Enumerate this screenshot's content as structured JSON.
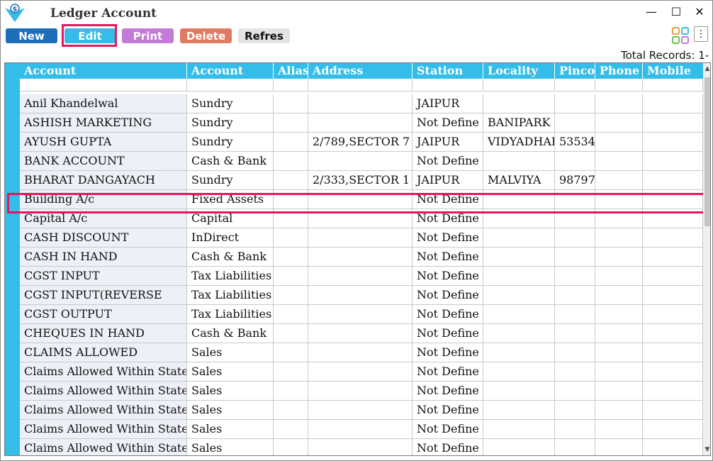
{
  "window": {
    "title": "Ledger Account",
    "minimize": "—",
    "maximize": "☐",
    "close": "✕"
  },
  "toolbar": {
    "buttons": [
      {
        "label": "New",
        "color": "#1f6fb8"
      },
      {
        "label": "Edit",
        "color": "#33bde8"
      },
      {
        "label": "Print",
        "color": "#c27bd6"
      },
      {
        "label": "Delete",
        "color": "#e07a62"
      },
      {
        "label": "Refres",
        "color": "#e3e3e3"
      }
    ],
    "kebab": "⋮"
  },
  "total_records": "Total Records: 1-",
  "table": {
    "columns": [
      "Account",
      "Account",
      "Alias",
      "Address",
      "Station",
      "Locality",
      "Pincod",
      "Phone",
      "Mobile"
    ],
    "rows": [
      [
        "Anil Khandelwal",
        "Sundry",
        "",
        "",
        "JAIPUR",
        "",
        "",
        "",
        ""
      ],
      [
        "ASHISH MARKETING",
        "Sundry",
        "",
        "",
        "Not Define",
        "BANIPARK",
        "",
        "",
        ""
      ],
      [
        "AYUSH GUPTA",
        "Sundry",
        "",
        "2/789,SECTOR 7",
        "JAIPUR",
        "VIDYADHAR",
        "53534",
        "",
        ""
      ],
      [
        "BANK ACCOUNT",
        "Cash & Bank",
        "",
        "",
        "Not Define",
        "",
        "",
        "",
        ""
      ],
      [
        "BHARAT DANGAYACH",
        "Sundry",
        "",
        "2/333,SECTOR 1",
        "JAIPUR",
        "MALVIYA",
        "98797",
        "",
        ""
      ],
      [
        "Building A/c",
        "Fixed Assets",
        "",
        "",
        "Not Define",
        "",
        "",
        "",
        ""
      ],
      [
        "Capital A/c",
        "Capital",
        "",
        "",
        "Not Define",
        "",
        "",
        "",
        ""
      ],
      [
        "CASH DISCOUNT",
        "InDirect",
        "",
        "",
        "Not Define",
        "",
        "",
        "",
        ""
      ],
      [
        "CASH IN HAND",
        "Cash & Bank",
        "",
        "",
        "Not Define",
        "",
        "",
        "",
        ""
      ],
      [
        "CGST INPUT",
        "Tax Liabilities",
        "",
        "",
        "Not Define",
        "",
        "",
        "",
        ""
      ],
      [
        "CGST INPUT(REVERSE",
        "Tax Liabilities",
        "",
        "",
        "Not Define",
        "",
        "",
        "",
        ""
      ],
      [
        "CGST OUTPUT",
        "Tax Liabilities",
        "",
        "",
        "Not Define",
        "",
        "",
        "",
        ""
      ],
      [
        "CHEQUES IN HAND",
        "Cash & Bank",
        "",
        "",
        "Not Define",
        "",
        "",
        "",
        ""
      ],
      [
        "CLAIMS ALLOWED",
        "Sales",
        "",
        "",
        "Not Define",
        "",
        "",
        "",
        ""
      ],
      [
        "Claims Allowed Within State",
        "Sales",
        "",
        "",
        "Not Define",
        "",
        "",
        "",
        ""
      ],
      [
        "Claims Allowed Within State",
        "Sales",
        "",
        "",
        "Not Define",
        "",
        "",
        "",
        ""
      ],
      [
        "Claims Allowed Within State",
        "Sales",
        "",
        "",
        "Not Define",
        "",
        "",
        "",
        ""
      ],
      [
        "Claims Allowed Within State",
        "Sales",
        "",
        "",
        "Not Define",
        "",
        "",
        "",
        ""
      ],
      [
        "Claims Allowed Within State",
        "Sales",
        "",
        "",
        "Not Define",
        "",
        "",
        "",
        ""
      ]
    ]
  },
  "colors": {
    "accent": "#33bde8",
    "highlight": "#e8165c"
  }
}
